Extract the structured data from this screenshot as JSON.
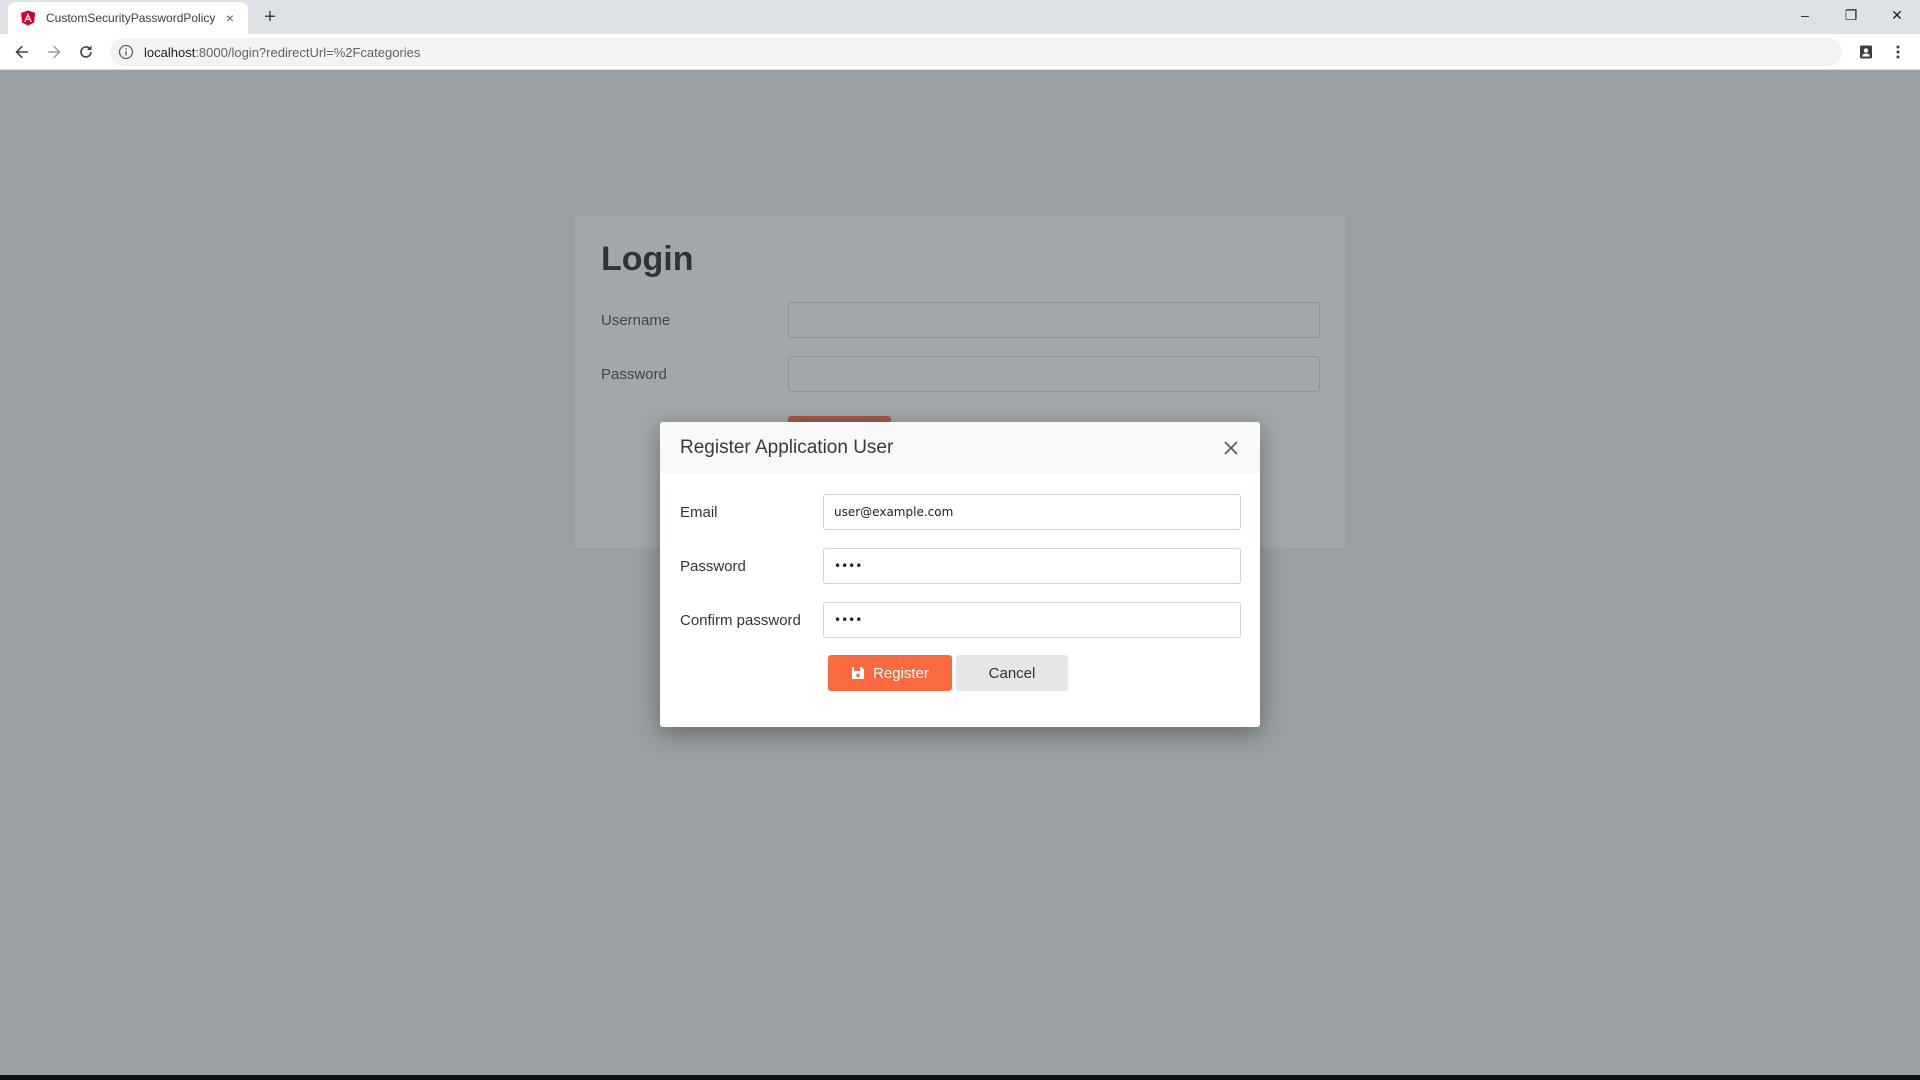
{
  "browser": {
    "tab_title": "CustomSecurityPasswordPolicy",
    "tab_close": "×",
    "new_tab": "+",
    "url_host": "localhost",
    "url_rest": ":8000/login?redirectUrl=%2Fcategories",
    "window_controls": {
      "minimize": "–",
      "restore": "❐",
      "close": "✕"
    }
  },
  "login": {
    "title": "Login",
    "username_label": "Username",
    "password_label": "Password"
  },
  "modal": {
    "title": "Register Application User",
    "fields": [
      {
        "label": "Email",
        "value": "user@example.com"
      },
      {
        "label": "Password",
        "value": "••••"
      },
      {
        "label": "Confirm password",
        "value": "••••"
      }
    ],
    "register_label": "Register",
    "cancel_label": "Cancel"
  },
  "colors": {
    "primary": "#f96a41",
    "overlay": "#999fa2",
    "secondary_button": "#e4e6e8"
  },
  "icons": [
    "angular-favicon-icon",
    "back-arrow-icon",
    "forward-arrow-icon",
    "reload-icon",
    "info-icon",
    "profile-icon",
    "menu-dots-icon",
    "close-icon",
    "save-icon"
  ]
}
